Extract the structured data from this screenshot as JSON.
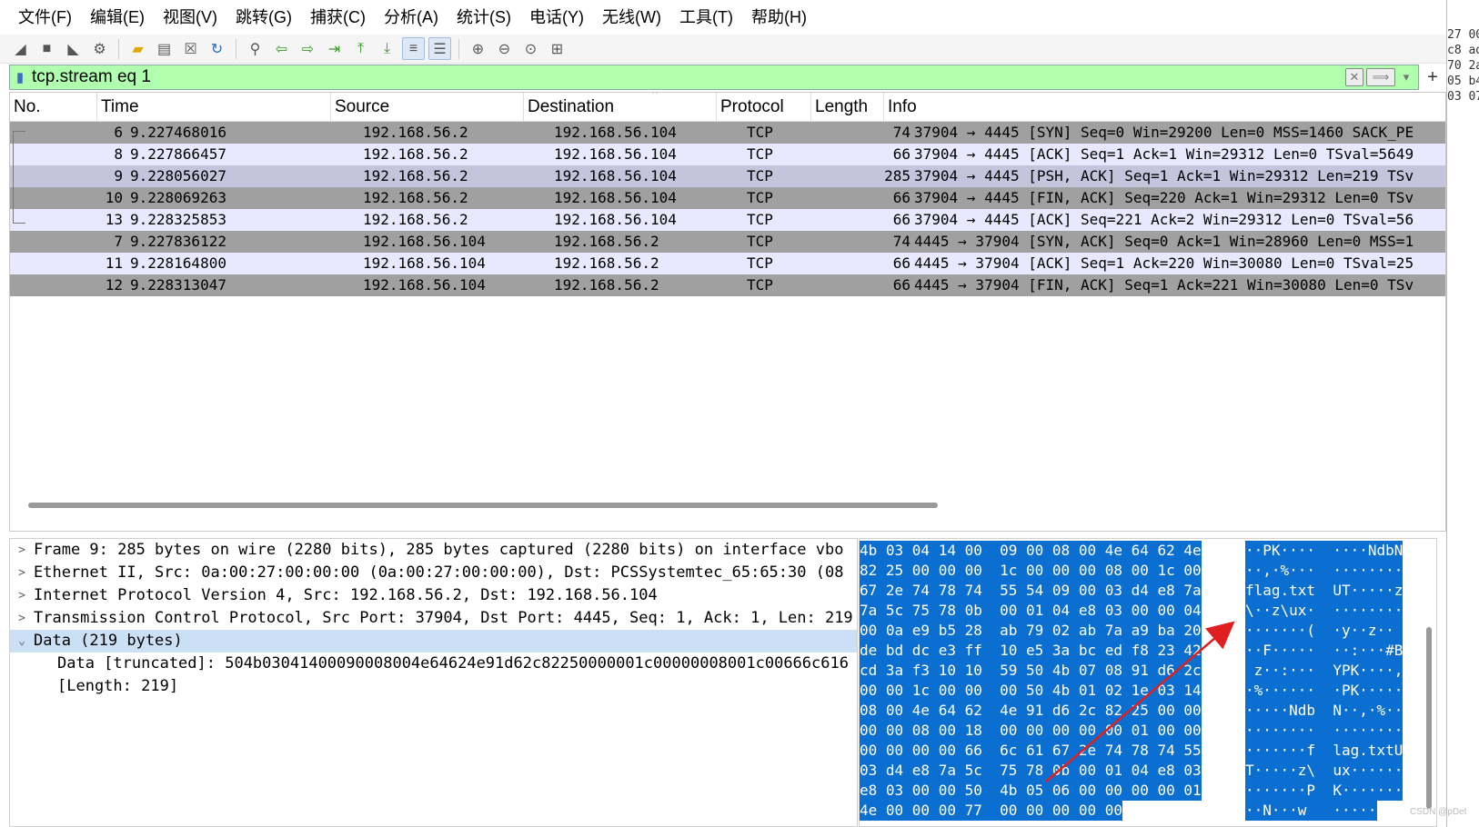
{
  "menubar": {
    "items": [
      "文件(F)",
      "编辑(E)",
      "视图(V)",
      "跳转(G)",
      "捕获(C)",
      "分析(A)",
      "统计(S)",
      "电话(Y)",
      "无线(W)",
      "工具(T)",
      "帮助(H)"
    ]
  },
  "filter": {
    "value": "tcp.stream eq 1",
    "plus": "+"
  },
  "columns": [
    "No.",
    "Time",
    "Source",
    "Destination",
    "Protocol",
    "Length",
    "Info"
  ],
  "packets": [
    {
      "no": "6",
      "time": "9.227468016",
      "src": "192.168.56.2",
      "dst": "192.168.56.104",
      "proto": "TCP",
      "len": "74",
      "info": "37904 → 4445 [SYN] Seq=0 Win=29200 Len=0 MSS=1460 SACK_PE"
    },
    {
      "no": "8",
      "time": "9.227866457",
      "src": "192.168.56.2",
      "dst": "192.168.56.104",
      "proto": "TCP",
      "len": "66",
      "info": "37904 → 4445 [ACK] Seq=1 Ack=1 Win=29312 Len=0 TSval=5649"
    },
    {
      "no": "9",
      "time": "9.228056027",
      "src": "192.168.56.2",
      "dst": "192.168.56.104",
      "proto": "TCP",
      "len": "285",
      "info": "37904 → 4445 [PSH, ACK] Seq=1 Ack=1 Win=29312 Len=219 TSv"
    },
    {
      "no": "10",
      "time": "9.228069263",
      "src": "192.168.56.2",
      "dst": "192.168.56.104",
      "proto": "TCP",
      "len": "66",
      "info": "37904 → 4445 [FIN, ACK] Seq=220 Ack=1 Win=29312 Len=0 TSv"
    },
    {
      "no": "13",
      "time": "9.228325853",
      "src": "192.168.56.2",
      "dst": "192.168.56.104",
      "proto": "TCP",
      "len": "66",
      "info": "37904 → 4445 [ACK] Seq=221 Ack=2 Win=29312 Len=0 TSval=56"
    },
    {
      "no": "7",
      "time": "9.227836122",
      "src": "192.168.56.104",
      "dst": "192.168.56.2",
      "proto": "TCP",
      "len": "74",
      "info": "4445 → 37904 [SYN, ACK] Seq=0 Ack=1 Win=28960 Len=0 MSS=1"
    },
    {
      "no": "11",
      "time": "9.228164800",
      "src": "192.168.56.104",
      "dst": "192.168.56.2",
      "proto": "TCP",
      "len": "66",
      "info": "4445 → 37904 [ACK] Seq=1 Ack=220 Win=30080 Len=0 TSval=25"
    },
    {
      "no": "12",
      "time": "9.228313047",
      "src": "192.168.56.104",
      "dst": "192.168.56.2",
      "proto": "TCP",
      "len": "66",
      "info": "4445 → 37904 [FIN, ACK] Seq=1 Ack=221 Win=30080 Len=0 TSv"
    }
  ],
  "details": [
    "Frame 9: 285 bytes on wire (2280 bits), 285 bytes captured (2280 bits) on interface vbo",
    "Ethernet II, Src: 0a:00:27:00:00:00 (0a:00:27:00:00:00), Dst: PCSSystemtec_65:65:30 (08",
    "Internet Protocol Version 4, Src: 192.168.56.2, Dst: 192.168.56.104",
    "Transmission Control Protocol, Src Port: 37904, Dst Port: 4445, Seq: 1, Ack: 1, Len: 219",
    "Data (219 bytes)",
    "Data [truncated]: 504b03041400090008004e64624e91d62c82250000001c00000008001c00666c616",
    "[Length: 219]"
  ],
  "hex": [
    [
      "4b 03 04 14 00  09 00 08 00 4e 64 62 4e",
      "··PK····  ····NdbN"
    ],
    [
      "82 25 00 00 00  1c 00 00 00 08 00 1c 00",
      "··,·%···  ········"
    ],
    [
      "67 2e 74 78 74  55 54 09 00 03 d4 e8 7a",
      "flag.txt  UT·····z"
    ],
    [
      "7a 5c 75 78 0b  00 01 04 e8 03 00 00 04",
      "\\··z\\ux·  ········"
    ],
    [
      "00 0a e9 b5 28  ab 79 02 ab 7a a9 ba 20",
      "·······(  ·y··z·· "
    ],
    [
      "de bd dc e3 ff  10 e5 3a bc ed f8 23 42",
      "··F·····  ··:···#B"
    ],
    [
      "cd 3a f3 10 10  59 50 4b 07 08 91 d6 2c",
      " z··:···  YPK····,"
    ],
    [
      "00 00 1c 00 00  00 50 4b 01 02 1e 03 14",
      "·%······  ·PK·····"
    ],
    [
      "08 00 4e 64 62  4e 91 d6 2c 82 25 00 00",
      "·····Ndb  N··,·%··"
    ],
    [
      "00 00 08 00 18  00 00 00 00 00 01 00 00",
      "········  ········"
    ],
    [
      "00 00 00 00 66  6c 61 67 2e 74 78 74 55",
      "·······f  lag.txtU"
    ],
    [
      "03 d4 e8 7a 5c  75 78 0b 00 01 04 e8 03",
      "T·····z\\  ux······"
    ],
    [
      "e8 03 00 00 50  4b 05 06 00 00 00 00 01",
      "·······P  K·······"
    ],
    [
      "4e 00 00 00 77  00 00 00 00 00",
      "··N···w   ·····"
    ]
  ],
  "right_strip": [
    "27 00",
    "c8 ad",
    "70 2a",
    "05 b4",
    "03 07"
  ],
  "watermark": "CSDN @pDet",
  "colors": {
    "filter_ok": "#afffaf",
    "row_gray": "#a0a0a0",
    "row_light": "#e8e8ff",
    "hex_select": "#0a6fd0",
    "annotation_arrow": "#e02020"
  }
}
